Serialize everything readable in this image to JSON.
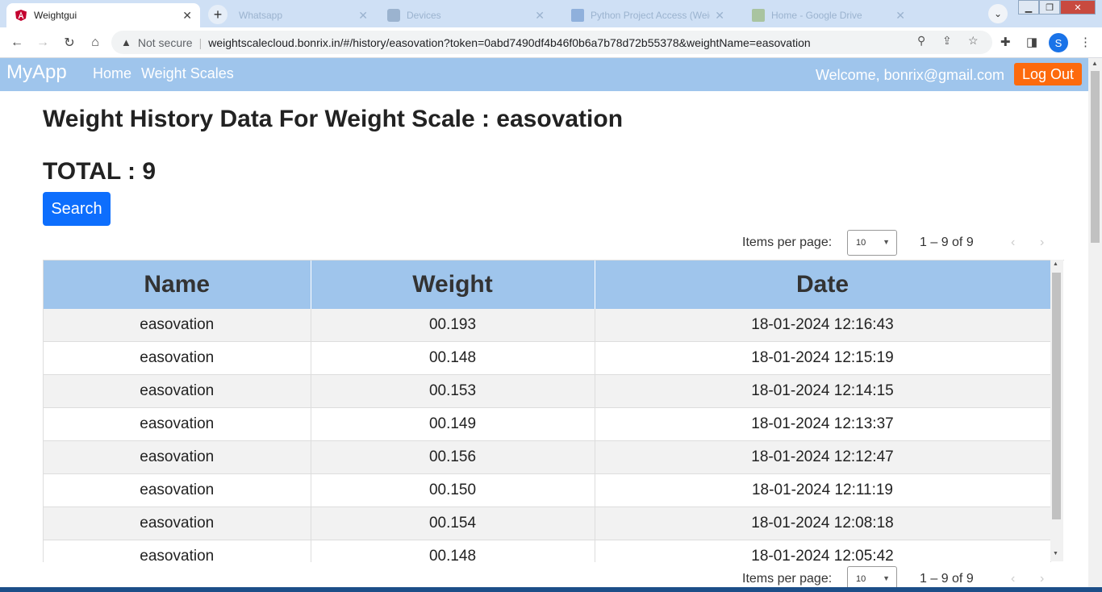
{
  "browser": {
    "active_tab_title": "Weightgui",
    "inactive_tabs": [
      "Whatsapp",
      "Devices",
      "Python Project Access (Weigh...",
      "Home - Google Drive"
    ],
    "not_secure_label": "Not secure",
    "url": "weightscalecloud.bonrix.in/#/history/easovation?token=0abd7490df4b46f0b6a7b78d72b55378&weightName=easovation",
    "profile_initial": "S"
  },
  "navbar": {
    "brand": "MyApp",
    "links": [
      "Home",
      "Weight Scales"
    ],
    "welcome": "Welcome, bonrix@gmail.com",
    "logout_label": "Log Out"
  },
  "page": {
    "title": "Weight History Data For Weight Scale : easovation",
    "total": "TOTAL : 9",
    "search_label": "Search"
  },
  "paginator": {
    "items_per_page_label": "Items per page:",
    "page_size": "10",
    "range_label": "1 – 9 of 9"
  },
  "table": {
    "columns": [
      "Name",
      "Weight",
      "Date"
    ],
    "rows": [
      [
        "easovation",
        "00.193",
        "18-01-2024 12:16:43"
      ],
      [
        "easovation",
        "00.148",
        "18-01-2024 12:15:19"
      ],
      [
        "easovation",
        "00.153",
        "18-01-2024 12:14:15"
      ],
      [
        "easovation",
        "00.149",
        "18-01-2024 12:13:37"
      ],
      [
        "easovation",
        "00.156",
        "18-01-2024 12:12:47"
      ],
      [
        "easovation",
        "00.150",
        "18-01-2024 12:11:19"
      ],
      [
        "easovation",
        "00.154",
        "18-01-2024 12:08:18"
      ],
      [
        "easovation",
        "00.148",
        "18-01-2024 12:05:42"
      ]
    ]
  },
  "colors": {
    "navbar": "#9fc5ec",
    "logout": "#fd6a0d",
    "search": "#0d6efd"
  }
}
